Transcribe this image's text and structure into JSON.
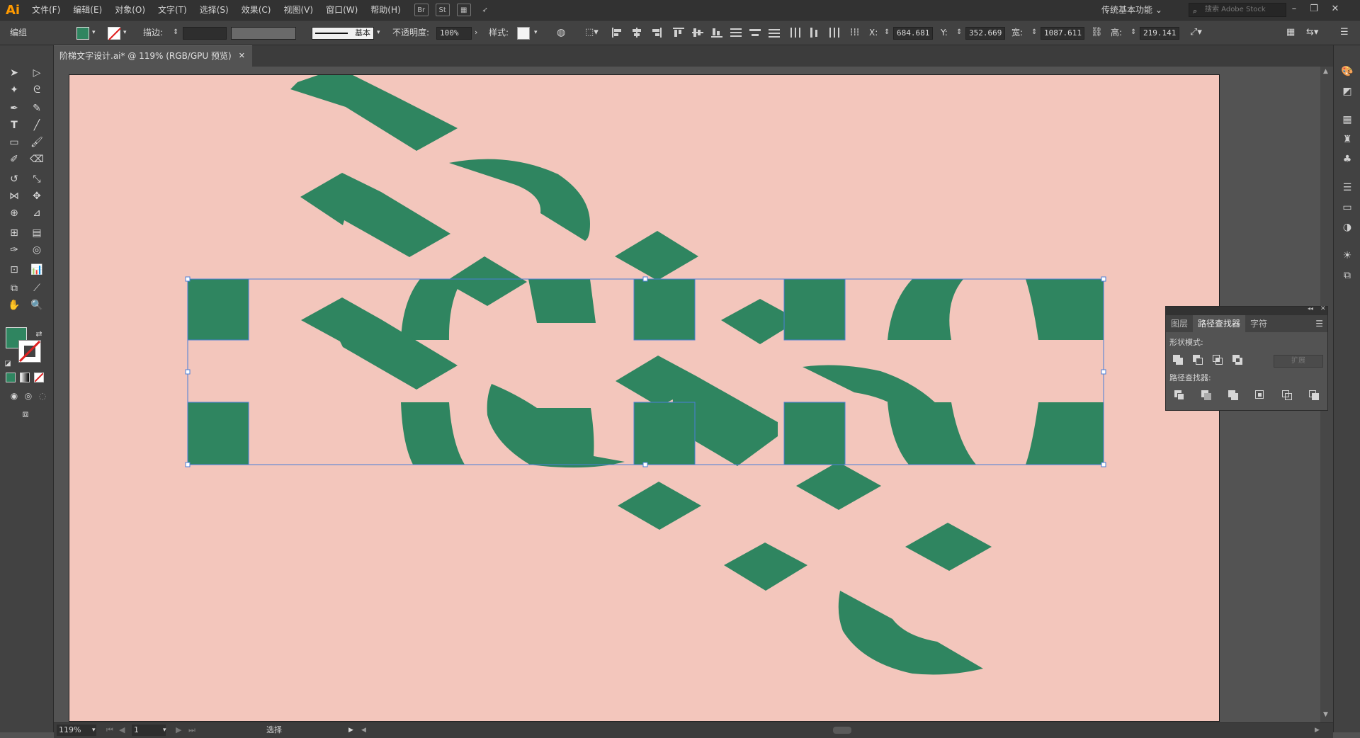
{
  "app": {
    "logo": "Ai"
  },
  "menu": {
    "items": [
      "文件(F)",
      "编辑(E)",
      "对象(O)",
      "文字(T)",
      "选择(S)",
      "效果(C)",
      "视图(V)",
      "窗口(W)",
      "帮助(H)"
    ],
    "bridge_label": "Br",
    "stock_label": "St",
    "workspace": "传统基本功能",
    "search_placeholder": "搜索 Adobe Stock"
  },
  "control": {
    "selection_type": "编组",
    "stroke_label": "描边:",
    "brush_label": "基本",
    "opacity_label": "不透明度:",
    "opacity_value": "100%",
    "style_label": "样式:",
    "x_label": "X:",
    "x_value": "684.681",
    "y_label": "Y:",
    "y_value": "352.669",
    "w_label": "宽:",
    "w_value": "1087.611",
    "h_label": "高:",
    "h_value": "219.141",
    "fill_color": "#2f8560"
  },
  "document": {
    "tab_title": "阶梯文字设计.ai* @ 119% (RGB/GPU 预览)",
    "artboard_color": "#f3c6bc",
    "shape_color": "#2f8560",
    "selection_color": "#4a7fd8"
  },
  "pathfinder": {
    "tabs": [
      "图层",
      "路径查找器",
      "字符"
    ],
    "active_tab": "路径查找器",
    "shape_modes_label": "形状模式:",
    "pathfinders_label": "路径查找器:",
    "expand_label": "扩展"
  },
  "status": {
    "zoom": "119%",
    "page": "1",
    "tool_name": "选择"
  }
}
